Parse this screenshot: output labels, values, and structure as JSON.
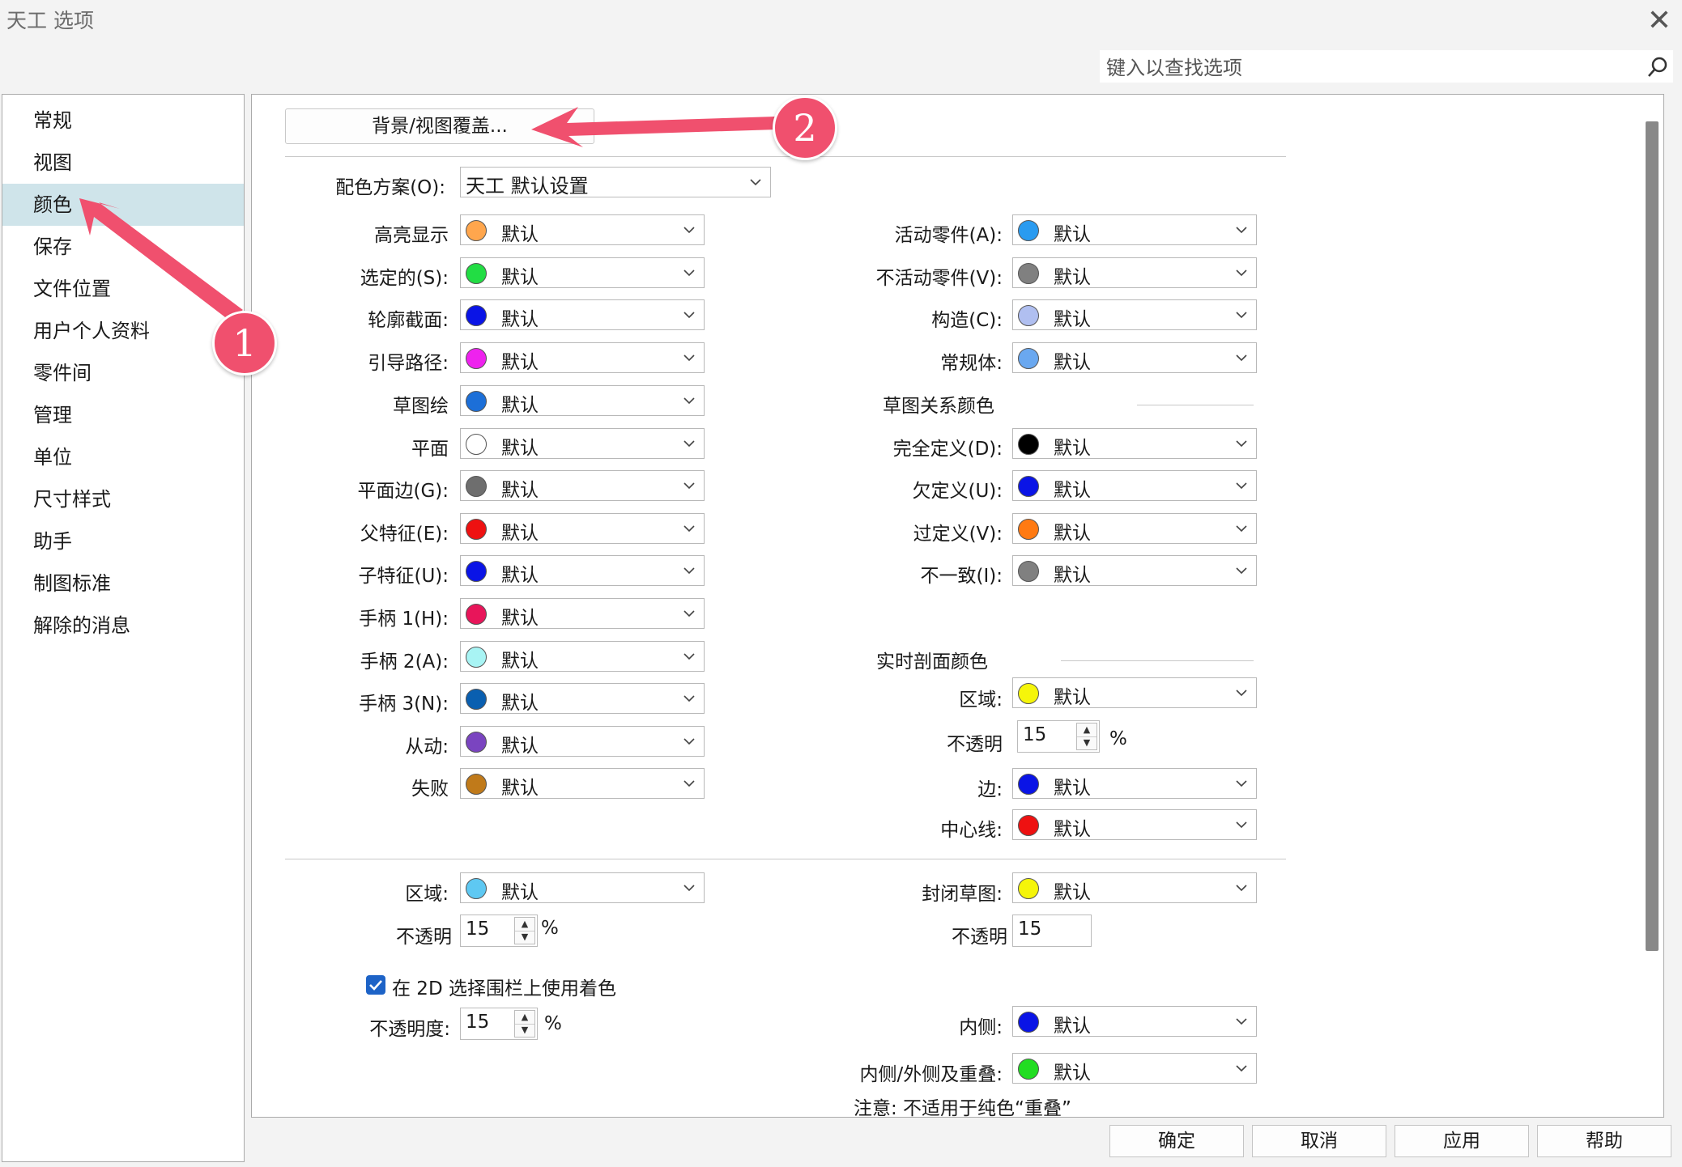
{
  "window": {
    "title": "天工 选项",
    "close_icon": "close-icon"
  },
  "search": {
    "placeholder": "键入以查找选项",
    "icon": "search-icon"
  },
  "sidebar": {
    "items": [
      {
        "label": "常规",
        "selected": false
      },
      {
        "label": "视图",
        "selected": false
      },
      {
        "label": "颜色",
        "selected": true
      },
      {
        "label": "保存",
        "selected": false
      },
      {
        "label": "文件位置",
        "selected": false
      },
      {
        "label": "用户个人资料",
        "selected": false
      },
      {
        "label": "零件间",
        "selected": false
      },
      {
        "label": "管理",
        "selected": false
      },
      {
        "label": "单位",
        "selected": false
      },
      {
        "label": "尺寸样式",
        "selected": false
      },
      {
        "label": "助手",
        "selected": false
      },
      {
        "label": "制图标准",
        "selected": false
      },
      {
        "label": "解除的消息",
        "selected": false
      }
    ]
  },
  "top_button": {
    "label": "背景/视图覆盖..."
  },
  "scheme": {
    "label": "配色方案(O):",
    "value": "天工 默认设置"
  },
  "left_colors": [
    {
      "label": "高亮显示",
      "value": "默认",
      "color": "#ffa64d"
    },
    {
      "label": "选定的(S):",
      "value": "默认",
      "color": "#22dd44"
    },
    {
      "label": "轮廓截面:",
      "value": "默认",
      "color": "#0a14e6"
    },
    {
      "label": "引导路径:",
      "value": "默认",
      "color": "#ee22ee"
    },
    {
      "label": "草图绘",
      "value": "默认",
      "color": "#1c6fd8"
    },
    {
      "label": "平面",
      "value": "默认",
      "color": "#ffffff"
    },
    {
      "label": "平面边(G):",
      "value": "默认",
      "color": "#6e6e6e"
    },
    {
      "label": "父特征(E):",
      "value": "默认",
      "color": "#ee1111"
    },
    {
      "label": "子特征(U):",
      "value": "默认",
      "color": "#0a14e6"
    },
    {
      "label": "手柄 1(H):",
      "value": "默认",
      "color": "#e8155a"
    },
    {
      "label": "手柄 2(A):",
      "value": "默认",
      "color": "#a8f4f4"
    },
    {
      "label": "手柄 3(N):",
      "value": "默认",
      "color": "#0a5fb0"
    },
    {
      "label": "从动:",
      "value": "默认",
      "color": "#7a44c0"
    },
    {
      "label": "失败",
      "value": "默认",
      "color": "#c07a1a"
    }
  ],
  "right_colors": [
    {
      "label": "活动零件(A):",
      "value": "默认",
      "color": "#2a9bf0"
    },
    {
      "label": "不活动零件(V):",
      "value": "默认",
      "color": "#808080"
    },
    {
      "label": "构造(C):",
      "value": "默认",
      "color": "#b0bff0"
    },
    {
      "label": "常规体:",
      "value": "默认",
      "color": "#6aa8f0"
    }
  ],
  "sketch_relations": {
    "heading": "草图关系颜色",
    "items": [
      {
        "label": "完全定义(D):",
        "value": "默认",
        "color": "#000000"
      },
      {
        "label": "欠定义(U):",
        "value": "默认",
        "color": "#0a14e6"
      },
      {
        "label": "过定义(V):",
        "value": "默认",
        "color": "#ff7a12"
      },
      {
        "label": "不一致(I):",
        "value": "默认",
        "color": "#808080"
      }
    ]
  },
  "live_section": {
    "heading": "实时剖面颜色",
    "region": {
      "label": "区域:",
      "value": "默认",
      "color": "#f5f50a"
    },
    "opacity": {
      "label": "不透明",
      "value": "15",
      "unit": "%"
    },
    "edge": {
      "label": "边:",
      "value": "默认",
      "color": "#0a14e6"
    },
    "centerline": {
      "label": "中心线:",
      "value": "默认",
      "color": "#ee1111"
    }
  },
  "bottom": {
    "region": {
      "label": "区域:",
      "value": "默认",
      "color": "#5ec8f2"
    },
    "region_opacity": {
      "label": "不透明",
      "value": "15",
      "unit": "%"
    },
    "closed_sketch": {
      "label": "封闭草图:",
      "value": "默认",
      "color": "#f5f50a"
    },
    "closed_opacity": {
      "label": "不透明",
      "value": "15"
    },
    "checkbox": {
      "label": "在 2D 选择围栏上使用着色",
      "checked": true
    },
    "fence_opacity": {
      "label": "不透明度:",
      "value": "15",
      "unit": "%"
    },
    "inside": {
      "label": "内侧:",
      "value": "默认",
      "color": "#0a14e6"
    },
    "overlap": {
      "label": "内侧/外侧及重叠:",
      "value": "默认",
      "color": "#22dd22"
    },
    "note": "注意: 不适用于纯色“重叠”"
  },
  "dialog_buttons": {
    "ok": "确定",
    "cancel": "取消",
    "apply": "应用",
    "help": "帮助"
  },
  "annotations": {
    "badge1": "1",
    "badge2": "2",
    "color": "#f0506e"
  }
}
